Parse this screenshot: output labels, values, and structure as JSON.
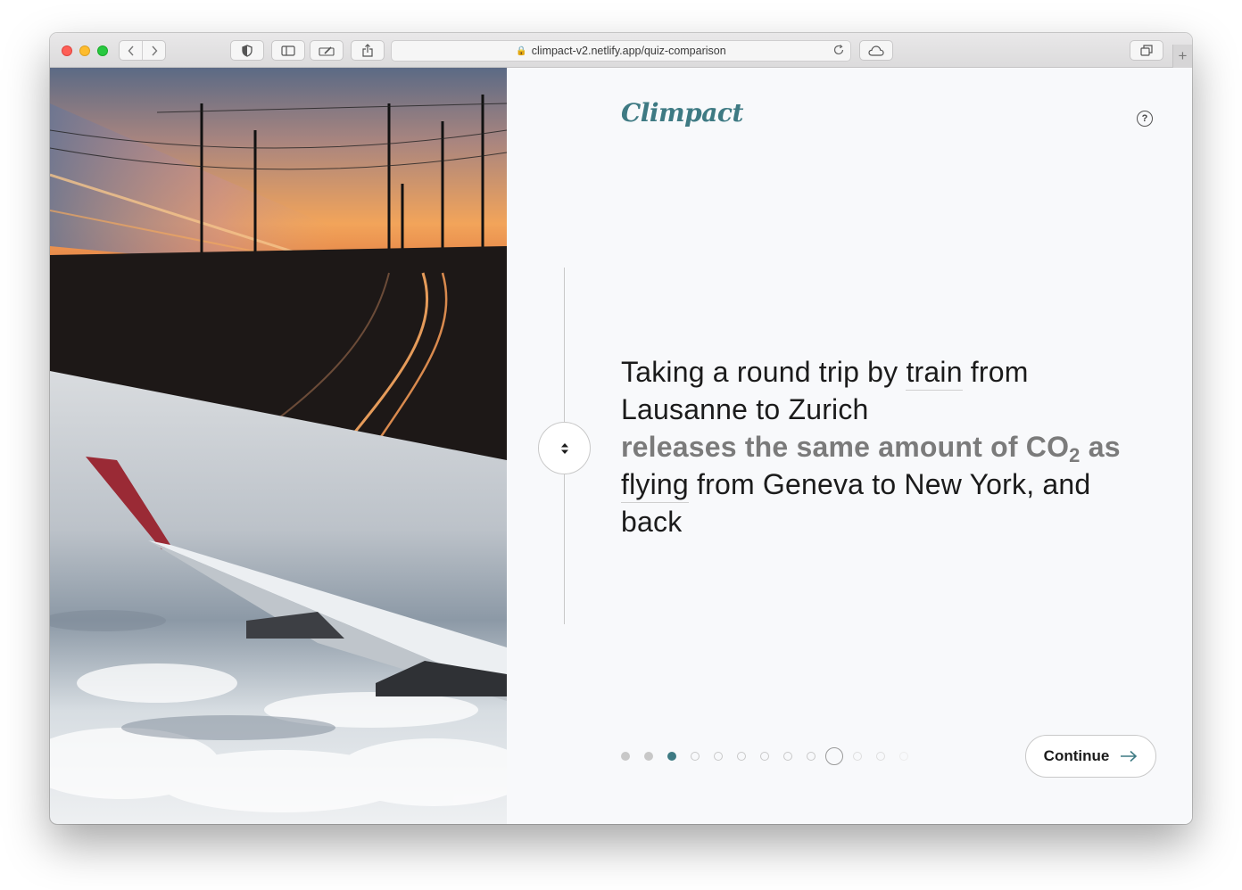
{
  "browser": {
    "url": "climpact-v2.netlify.app/quiz-comparison",
    "back_icon": "chevron-left-icon",
    "forward_icon": "chevron-right-icon",
    "new_tab_label": "+"
  },
  "app": {
    "logo": "Climpact",
    "help_label": "?",
    "accent_color": "#3e7a83"
  },
  "comparison": {
    "part1": "Taking a round trip by",
    "mode1": "train",
    "part2": "from Lausanne to Zurich",
    "highlight_before": "releases the same amount of CO",
    "highlight_sub": "2",
    "highlight_after": "as",
    "mode2": "flying",
    "part3": "from Geneva to New York, and back"
  },
  "progress": {
    "total_steps": 13,
    "current_step": 3
  },
  "actions": {
    "continue_label": "Continue"
  }
}
